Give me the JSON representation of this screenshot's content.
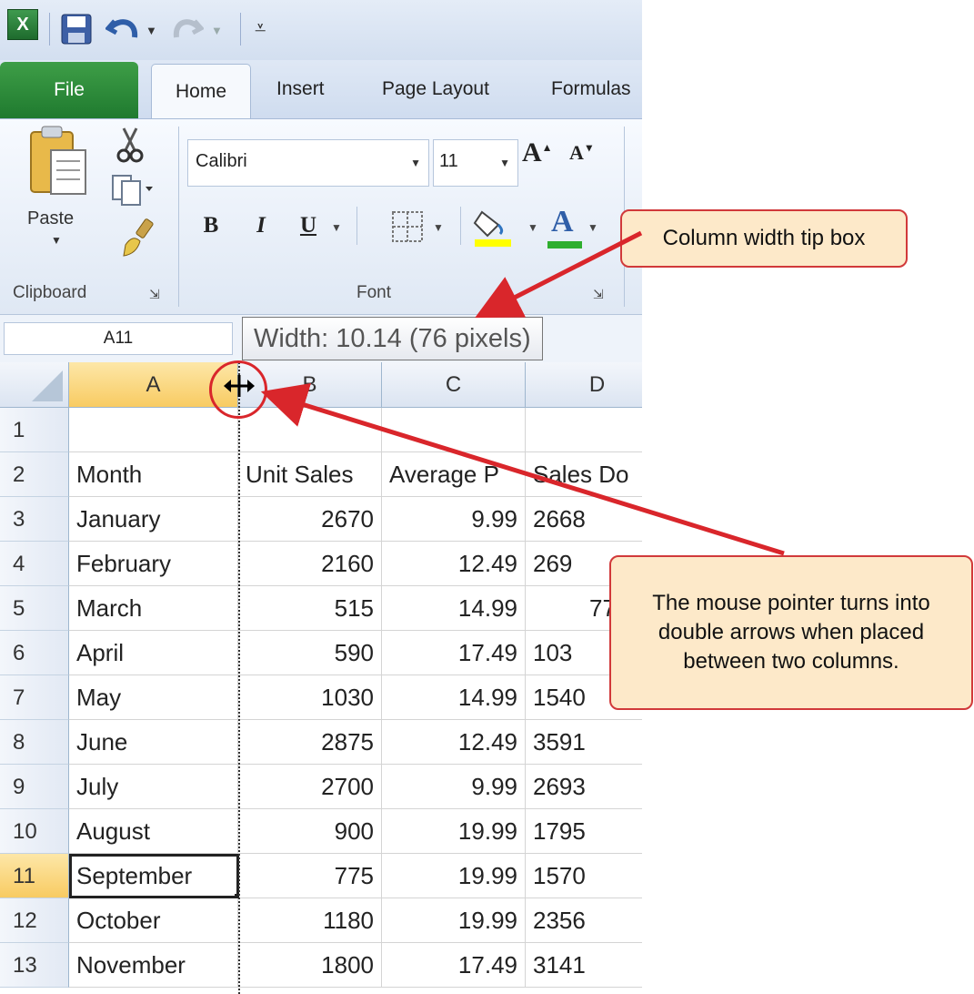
{
  "qat": {
    "save_icon": "save-icon",
    "undo_icon": "undo-icon",
    "redo_icon": "redo-icon"
  },
  "tabs": [
    "File",
    "Home",
    "Insert",
    "Page Layout",
    "Formulas"
  ],
  "ribbon": {
    "paste_label": "Paste",
    "clipboard_label": "Clipboard",
    "font_label": "Font",
    "font_name": "Calibri",
    "font_size": "11",
    "bold": "B",
    "italic": "I",
    "underline": "U",
    "grow_font": "A",
    "shrink_font": "A",
    "font_color": "A"
  },
  "formula_bar": {
    "name_box": "A11"
  },
  "tooltip": "Width: 10.14 (76 pixels)",
  "columns": [
    "A",
    "B",
    "C",
    "D"
  ],
  "rows": [
    {
      "n": "1",
      "month": "",
      "unit_sales": "",
      "avg_price": "",
      "sales_dollars": ""
    },
    {
      "n": "2",
      "month": "Month",
      "unit_sales": "Unit Sales",
      "avg_price": "Average P",
      "sales_dollars": "Sales Do"
    },
    {
      "n": "3",
      "month": "January",
      "unit_sales": "2670",
      "avg_price": "9.99",
      "sales_dollars": "2668"
    },
    {
      "n": "4",
      "month": "February",
      "unit_sales": "2160",
      "avg_price": "12.49",
      "sales_dollars": "269"
    },
    {
      "n": "5",
      "month": "March",
      "unit_sales": "515",
      "avg_price": "14.99",
      "sales_dollars": "77"
    },
    {
      "n": "6",
      "month": "April",
      "unit_sales": "590",
      "avg_price": "17.49",
      "sales_dollars": "103"
    },
    {
      "n": "7",
      "month": "May",
      "unit_sales": "1030",
      "avg_price": "14.99",
      "sales_dollars": "1540"
    },
    {
      "n": "8",
      "month": "June",
      "unit_sales": "2875",
      "avg_price": "12.49",
      "sales_dollars": "3591"
    },
    {
      "n": "9",
      "month": "July",
      "unit_sales": "2700",
      "avg_price": "9.99",
      "sales_dollars": "2693"
    },
    {
      "n": "10",
      "month": "August",
      "unit_sales": "900",
      "avg_price": "19.99",
      "sales_dollars": "1795"
    },
    {
      "n": "11",
      "month": "September",
      "unit_sales": "775",
      "avg_price": "19.99",
      "sales_dollars": "1570"
    },
    {
      "n": "12",
      "month": "October",
      "unit_sales": "1180",
      "avg_price": "19.99",
      "sales_dollars": "2356"
    },
    {
      "n": "13",
      "month": "November",
      "unit_sales": "1800",
      "avg_price": "17.49",
      "sales_dollars": "3141"
    }
  ],
  "callouts": {
    "column_width": "Column width tip box",
    "mouse_pointer": "The mouse pointer turns into double arrows when placed between two columns."
  },
  "colors": {
    "accent": "#d1393a",
    "callout_fill": "#fde9c9",
    "selected_header": "#f8cb62",
    "file_tab": "#1f7a2f"
  }
}
